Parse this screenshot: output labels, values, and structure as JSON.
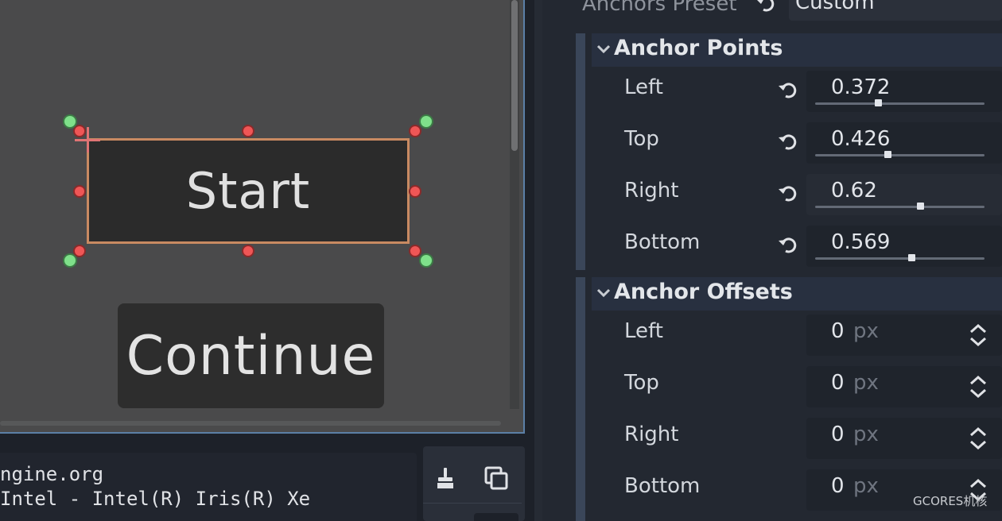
{
  "viewport": {
    "start_label": "Start",
    "continue_label": "Continue"
  },
  "output": {
    "lines": [
      "ngine.org",
      "Intel - Intel(R) Iris(R) Xe"
    ]
  },
  "inspector": {
    "anchors_preset_label": "Anchors Preset",
    "anchors_preset_value": "Custom",
    "anchor_points": {
      "title": "Anchor Points",
      "rows": [
        {
          "label": "Left",
          "value": "0.372",
          "level": 0.372
        },
        {
          "label": "Top",
          "value": "0.426",
          "level": 0.426
        },
        {
          "label": "Right",
          "value": "0.62",
          "level": 0.62
        },
        {
          "label": "Bottom",
          "value": "0.569",
          "level": 0.569
        }
      ]
    },
    "anchor_offsets": {
      "title": "Anchor Offsets",
      "rows": [
        {
          "label": "Left",
          "value": "0",
          "unit": "px"
        },
        {
          "label": "Top",
          "value": "0",
          "unit": "px"
        },
        {
          "label": "Right",
          "value": "0",
          "unit": "px"
        },
        {
          "label": "Bottom",
          "value": "0",
          "unit": "px"
        }
      ]
    }
  },
  "watermark": "GCORES机核",
  "colors": {
    "selection_outline": "#c98a62",
    "handle": "#ef5656",
    "anchor": "#7fe08a",
    "viewport_border": "#5b7fa6"
  },
  "icons": [
    "reset-icon",
    "chevron-down-icon",
    "spinner-icon",
    "broom-icon",
    "copy-icon"
  ]
}
